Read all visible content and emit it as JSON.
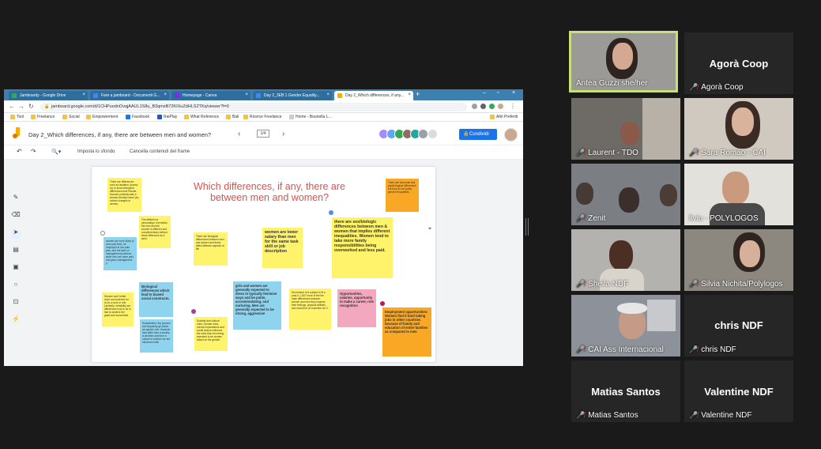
{
  "browser": {
    "tabs": [
      {
        "label": "Jamboardy - Google Drive",
        "color": "#34a853"
      },
      {
        "label": "Fare a jamboard - Documenti G...",
        "color": "#4285f4"
      },
      {
        "label": "Homepage - Canva",
        "color": "#7d2ae8"
      },
      {
        "label": "Day 2_3EB 1 Gender Equality...",
        "color": "#4285f4"
      },
      {
        "label": "Day 2_Which differences, if any...",
        "color": "#f9ab00"
      }
    ],
    "url": "jamboard.google.com/d/1CHPuodnOvqjAAUL1S8u_B3qmxB72KIXuZdHLS2TKq/viewer?f=0",
    "bookmarks": [
      "Tool",
      "Freelance",
      "Social",
      "Empowerment",
      "Facebook",
      "RaiPlay",
      "What Reference",
      "Bali",
      "Ricerce Freelance",
      "Home - Bounella L..."
    ],
    "other_bookmarks": "Altri Preferiti"
  },
  "jamboard": {
    "title": "Day 2_Which differences, if any, there are between men and women?",
    "frame_counter": "1/4",
    "share_label": "Condividi",
    "toolbar": {
      "set_background": "Imposta lo sfondo",
      "clear_frame": "Cancella contenuti del frame"
    },
    "board_title": "Which differences, if any, there are between men and women?",
    "notes": [
      {
        "text": "There are differences such as lactation, Ijeoma, eg. to know biological differences that Female-focused professionals a women-friendly linked (to) certain changes to access.",
        "color": "y"
      },
      {
        "text": "The different in personalign. Kennelled. the men and the women is different and complementary without these difference as it were.",
        "color": "y"
      },
      {
        "text": "women are more likely to work part-time, be employed in low-paid jobs, and not take on management positions while men are more paid and given management p.",
        "color": "b"
      },
      {
        "text": "There are biological differences between men and women and these affect different aspects of life",
        "color": "y"
      },
      {
        "text": "women are lower salary than men for the same task skill or job description",
        "color": "y"
      },
      {
        "text": "there are sex/biologic differences between men & women that implies different inequalities. Women tend to take more family responsibilities being overworked and less paid.",
        "color": "y"
      },
      {
        "text": "There are hormonal and psychological differences but they do not justify gender inequalities.",
        "color": "o"
      },
      {
        "text": "Biological differences which lead to biased social constructs.",
        "color": "b"
      },
      {
        "text": "Women can't better more and exercise for to do a work or role. Limitedly. Invisibility are differences how to do in fact to achieve the goals and succeeded.",
        "color": "y"
      },
      {
        "text": "Socialisation: the grooms are frequently gif (when we gender role. However they differ from a society to another and from a culture to another we are influenced with",
        "color": "b"
      },
      {
        "text": "Societal and cultural roles: Gender roles, normal expectations and social factors influence the roles that men being expected to be women based on the gender.",
        "color": "y"
      },
      {
        "text": "girls and women are generally expected to dress in typically feminine ways and be polite, accommodating, and nurturing. Men are generally expected to be strong, aggressive",
        "color": "b"
      },
      {
        "text": "Sex-biased of a subject to fit a post-it ;) 16/7 more of the the male differences between women and men they express their feelings, physical abilities, and should be an incentive for U.",
        "color": "y"
      },
      {
        "text": "Opportunities, salaries, opportunity to make a career, role recognition",
        "color": "p"
      },
      {
        "text": "Employment opportunities: Women find it hard taking jobs in other countries because of family and education of entire families as compared to men",
        "color": "o"
      }
    ]
  },
  "participants": [
    {
      "name": "Antea Guzzi she/her",
      "video": true,
      "active": true,
      "muted": false
    },
    {
      "name": "Agorà Coop",
      "video": false,
      "muted": true
    },
    {
      "name": "Laurent - TDO",
      "video": true,
      "muted": true
    },
    {
      "name": "Sara Romão - CAI",
      "video": true,
      "muted": true
    },
    {
      "name": "Zenit",
      "video": true,
      "muted": true
    },
    {
      "name": "liviu - POLYLOGOS",
      "video": true,
      "muted": false
    },
    {
      "name": "Sheila NDF",
      "video": true,
      "muted": true
    },
    {
      "name": "Silvia Nichita/Polylogos",
      "video": true,
      "muted": true
    },
    {
      "name": "CAI Ass Internacional",
      "video": true,
      "muted": true
    },
    {
      "name": "chris NDF",
      "video": false,
      "muted": true
    },
    {
      "name": "Matias Santos",
      "video": false,
      "muted": true
    },
    {
      "name": "Valentine NDF",
      "video": false,
      "muted": true
    }
  ],
  "colors": {
    "accent": "#1a73e8",
    "title_red": "#d9534f",
    "speaker_border": "#c8e07a",
    "muted_mic": "#e53935"
  },
  "icons": [
    "jamboard-logo-icon",
    "pen-icon",
    "eraser-icon",
    "select-icon",
    "sticky-note-icon",
    "image-icon",
    "shape-icon",
    "textbox-icon",
    "laser-icon",
    "zoom-icon",
    "undo-icon",
    "redo-icon",
    "muted-mic-icon"
  ]
}
